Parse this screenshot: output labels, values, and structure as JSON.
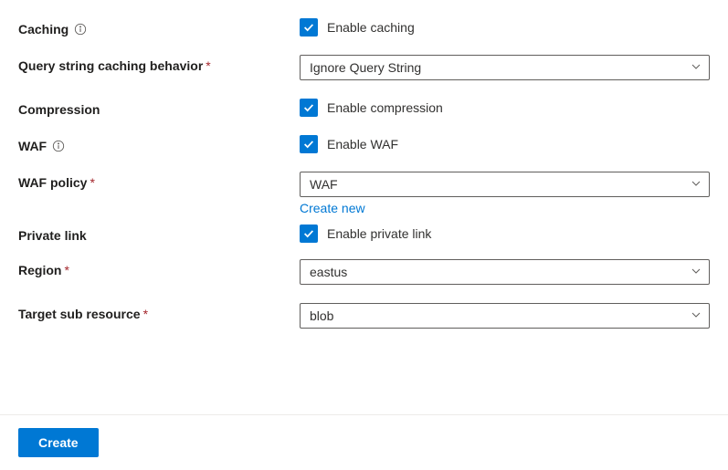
{
  "caching": {
    "label": "Caching",
    "checkbox_label": "Enable caching",
    "checked": true
  },
  "query_string": {
    "label": "Query string caching behavior",
    "required": true,
    "value": "Ignore Query String"
  },
  "compression": {
    "label": "Compression",
    "checkbox_label": "Enable compression",
    "checked": true
  },
  "waf": {
    "label": "WAF",
    "checkbox_label": "Enable WAF",
    "checked": true
  },
  "waf_policy": {
    "label": "WAF policy",
    "required": true,
    "value": "WAF",
    "create_new": "Create new"
  },
  "private_link": {
    "label": "Private link",
    "checkbox_label": "Enable private link",
    "checked": true
  },
  "region": {
    "label": "Region",
    "required": true,
    "value": "eastus"
  },
  "target_sub": {
    "label": "Target sub resource",
    "required": true,
    "value": "blob"
  },
  "footer": {
    "create": "Create"
  }
}
